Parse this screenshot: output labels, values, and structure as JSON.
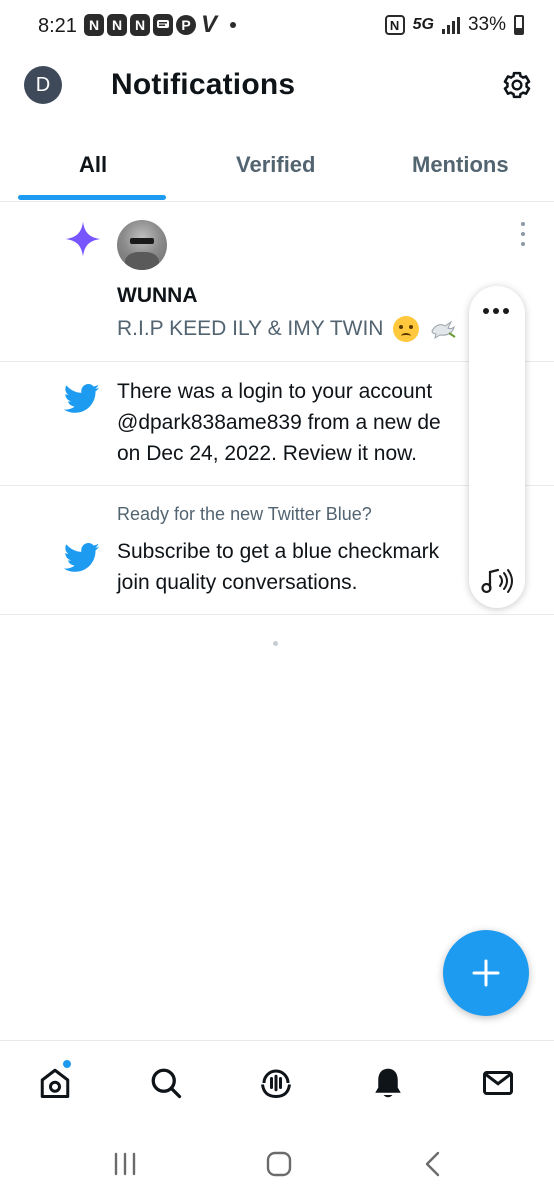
{
  "status_bar": {
    "time": "8:21",
    "app_icons": [
      "N",
      "N",
      "N",
      "msg",
      "P",
      "V"
    ],
    "nfc": "N",
    "network": "5G",
    "battery": "33%"
  },
  "header": {
    "avatar_letter": "D",
    "title": "Notifications"
  },
  "tabs": [
    {
      "label": "All",
      "active": true
    },
    {
      "label": "Verified",
      "active": false
    },
    {
      "label": "Mentions",
      "active": false
    }
  ],
  "notifications": [
    {
      "type": "highlight",
      "icon": "sparkle-icon",
      "user": "WUNNA",
      "text": "R.I.P KEED ILY & IMY TWIN"
    },
    {
      "type": "security",
      "icon": "twitter-bird-icon",
      "lines": [
        "There was a login to your account",
        "@dpark838ame839 from a new de",
        "on Dec 24, 2022. Review it now."
      ]
    },
    {
      "type": "promo",
      "icon": "twitter-bird-icon",
      "subtitle": "Ready for the new Twitter Blue?",
      "lines": [
        "Subscribe to get a blue checkmark",
        "join quality conversations."
      ]
    }
  ],
  "fab": {
    "icon": "plus-icon"
  },
  "bottom_nav": [
    {
      "name": "home",
      "icon": "home-icon",
      "has_badge": true
    },
    {
      "name": "search",
      "icon": "search-icon",
      "has_badge": false
    },
    {
      "name": "spaces",
      "icon": "spaces-icon",
      "has_badge": false
    },
    {
      "name": "notifications",
      "icon": "bell-icon",
      "has_badge": false
    },
    {
      "name": "messages",
      "icon": "mail-icon",
      "has_badge": false
    }
  ],
  "colors": {
    "accent": "#1d9bf0",
    "sparkle": "#7856ff",
    "text_primary": "#0f1419",
    "text_secondary": "#536471"
  }
}
